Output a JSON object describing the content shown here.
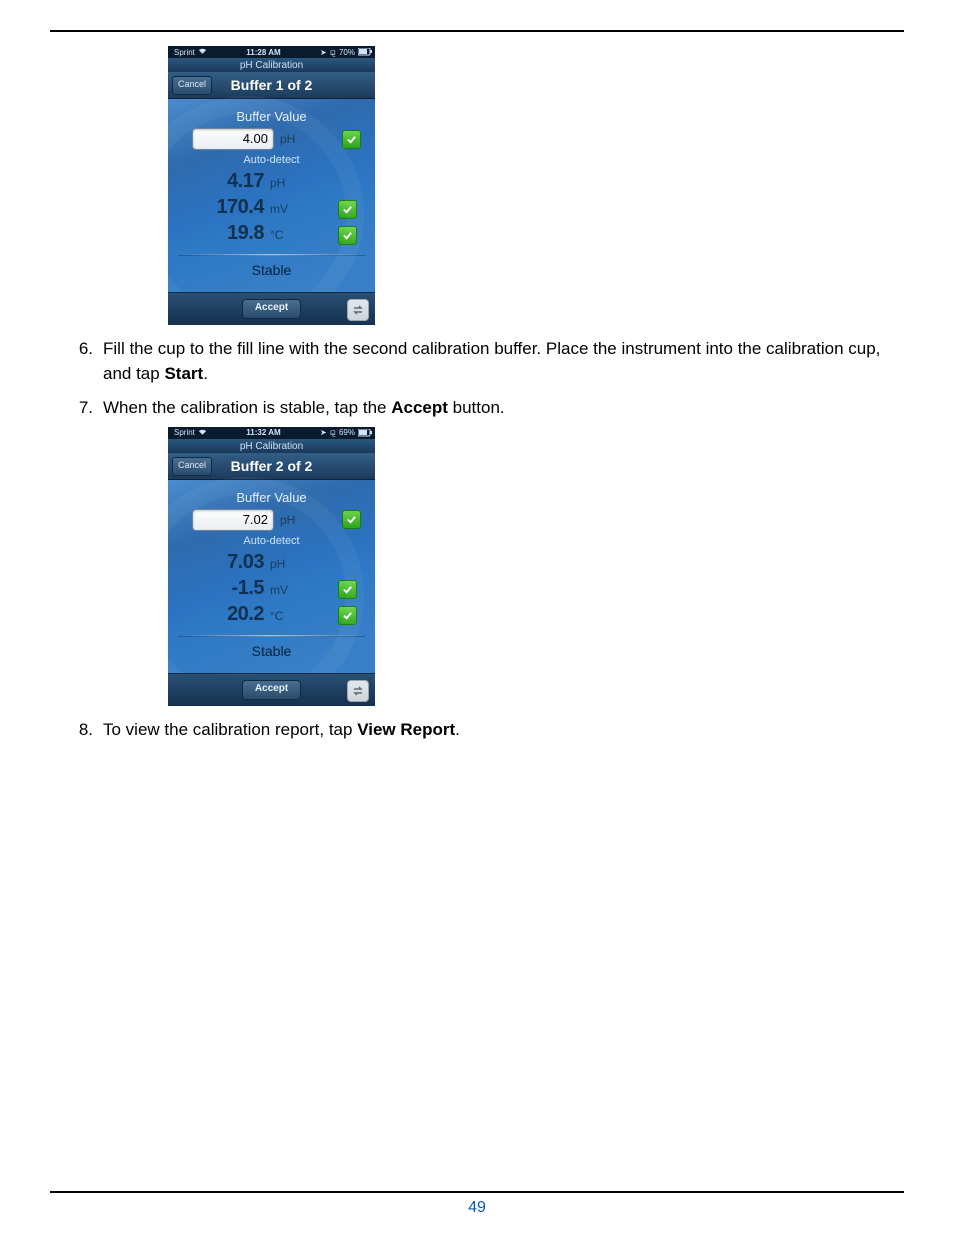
{
  "page_number": "49",
  "steps": [
    {
      "num": "6.",
      "text_pre": "Fill the cup to the fill line with the second calibration buffer. Place the instrument into the calibration cup, and tap ",
      "bold": "Start",
      "text_post": "."
    },
    {
      "num": "7.",
      "text_pre": "When the calibration is stable, tap the ",
      "bold": "Accept",
      "text_post": " button."
    },
    {
      "num": "8.",
      "text_pre": "To view the calibration report, tap ",
      "bold": "View Report",
      "text_post": "."
    }
  ],
  "screens": [
    {
      "status": {
        "carrier": "Sprint",
        "time": "11:28 AM",
        "battery": "70%"
      },
      "app_title": "pH Calibration",
      "cancel_label": "Cancel",
      "buffer_title": "Buffer 1 of 2",
      "buffer_value_label": "Buffer Value",
      "buffer_input": "4.00",
      "buffer_unit": "pH",
      "auto_detect_label": "Auto-detect",
      "readings": [
        {
          "value": "4.17",
          "unit": "pH",
          "check": false
        },
        {
          "value": "170.4",
          "unit": "mV",
          "check": true
        },
        {
          "value": "19.8",
          "unit": "°C",
          "check": true
        }
      ],
      "stable_label": "Stable",
      "accept_label": "Accept"
    },
    {
      "status": {
        "carrier": "Sprint",
        "time": "11:32 AM",
        "battery": "69%"
      },
      "app_title": "pH Calibration",
      "cancel_label": "Cancel",
      "buffer_title": "Buffer 2 of 2",
      "buffer_value_label": "Buffer Value",
      "buffer_input": "7.02",
      "buffer_unit": "pH",
      "auto_detect_label": "Auto-detect",
      "readings": [
        {
          "value": "7.03",
          "unit": "pH",
          "check": false
        },
        {
          "value": "-1.5",
          "unit": "mV",
          "check": true
        },
        {
          "value": "20.2",
          "unit": "°C",
          "check": true
        }
      ],
      "stable_label": "Stable",
      "accept_label": "Accept"
    }
  ]
}
